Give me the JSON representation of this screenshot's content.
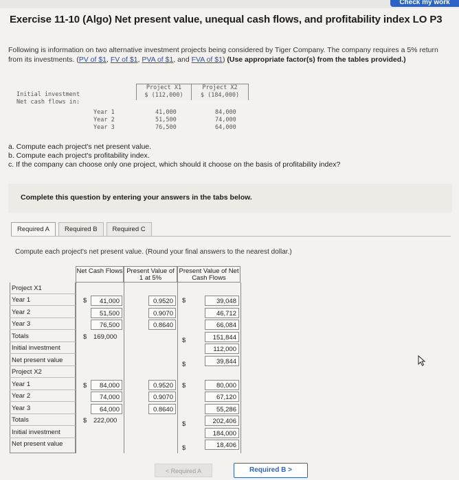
{
  "header": {
    "check_label": "Check my work"
  },
  "title": "Exercise 11-10 (Algo) Net present value, unequal cash flows, and profitability index LO P3",
  "intro": {
    "text": "Following is information on two alternative investment projects being considered by Tiger Company. The company requires a 5% return from its investments.",
    "links": [
      "PV of $1",
      "FV of $1",
      "PVA of $1",
      "FVA of $1"
    ],
    "link_prefix": "(",
    "link_suffix": ")",
    "bold": "(Use appropriate factor(s) from the tables provided.)"
  },
  "given": {
    "col1": "Project X1",
    "col2": "Project X2",
    "initial_label": "Initial investment",
    "net_label": "Net cash flows in:",
    "x1_initial": "$ (112,000)",
    "x2_initial": "$ (184,000)",
    "years": [
      "Year 1",
      "Year 2",
      "Year 3"
    ],
    "x1_flows": [
      "41,000",
      "51,500",
      "76,500"
    ],
    "x2_flows": [
      "84,000",
      "74,000",
      "64,000"
    ]
  },
  "questions": [
    "a. Compute each project's net present value.",
    "b. Compute each project's profitability index.",
    "c. If the company can choose only one project, which should it choose on the basis of profitability index?"
  ],
  "complete_text": "Complete this question by entering your answers in the tabs below.",
  "tabs": [
    "Required A",
    "Required B",
    "Required C"
  ],
  "instruction": "Compute each project's net present value. (Round your final answers to the nearest dollar.)",
  "table": {
    "headers": [
      "Net Cash Flows",
      "Present Value of 1 at 5%",
      "Present Value of Net Cash Flows"
    ],
    "row_labels": [
      "Project X1",
      "Year 1",
      "Year 2",
      "Year 3",
      "Totals",
      "Initial investment",
      "Net present value",
      "Project X2",
      "Year 1",
      "Year 2",
      "Year 3",
      "Totals",
      "Initial investment",
      "Net present value"
    ],
    "x1": {
      "flows": [
        "41,000",
        "51,500",
        "76,500"
      ],
      "flows_total": "169,000",
      "factors": [
        "0.9520",
        "0.9070",
        "0.8640"
      ],
      "pv": [
        "39,048",
        "46,712",
        "66,084"
      ],
      "pv_total": "151,844",
      "initial": "112,000",
      "npv": "39,844"
    },
    "x2": {
      "flows": [
        "84,000",
        "74,000",
        "64,000"
      ],
      "flows_total": "222,000",
      "factors": [
        "0.9520",
        "0.9070",
        "0.8640"
      ],
      "pv": [
        "80,000",
        "67,120",
        "55,286"
      ],
      "pv_total": "202,406",
      "initial": "184,000",
      "npv": "18,406"
    },
    "dollar": "$"
  },
  "nav": {
    "prev": "Required A",
    "next": "Required B",
    "prev_arrow": "<",
    "next_arrow": ">"
  }
}
